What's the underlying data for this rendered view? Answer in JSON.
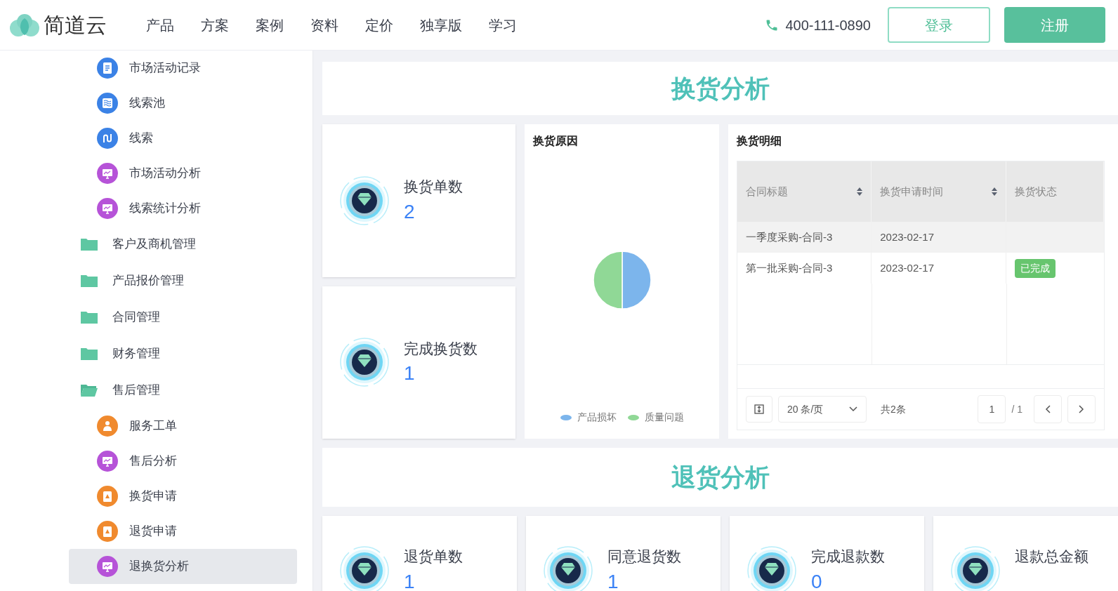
{
  "header": {
    "brand": "简道云",
    "nav": [
      "产品",
      "方案",
      "案例",
      "资料",
      "定价",
      "独享版",
      "学习"
    ],
    "phone": "400-111-0890",
    "login": "登录",
    "register": "注册"
  },
  "sidebar": {
    "upper_items": [
      {
        "label": "市场活动记录",
        "kind": "doc",
        "selected": false
      },
      {
        "label": "线索池",
        "kind": "wave",
        "selected": false
      },
      {
        "label": "线索",
        "kind": "route",
        "selected": false
      },
      {
        "label": "市场活动分析",
        "kind": "monitor",
        "selected": false
      },
      {
        "label": "线索统计分析",
        "kind": "monitor",
        "selected": false
      }
    ],
    "folders": [
      {
        "label": "客户及商机管理",
        "expanded": false
      },
      {
        "label": "产品报价管理",
        "expanded": false
      },
      {
        "label": "合同管理",
        "expanded": false
      },
      {
        "label": "财务管理",
        "expanded": false
      },
      {
        "label": "售后管理",
        "expanded": true,
        "children": [
          {
            "label": "服务工单",
            "kind": "person",
            "selected": false
          },
          {
            "label": "售后分析",
            "kind": "monitor",
            "selected": false
          },
          {
            "label": "换货申请",
            "kind": "clipboard",
            "selected": false
          },
          {
            "label": "退货申请",
            "kind": "clipboard",
            "selected": false
          },
          {
            "label": "退换货分析",
            "kind": "monitor",
            "selected": true
          }
        ]
      }
    ]
  },
  "exchange": {
    "title": "换货分析",
    "stats": [
      {
        "label": "换货单数",
        "value": "2"
      },
      {
        "label": "完成换货数",
        "value": "1"
      }
    ],
    "reason": {
      "title": "换货原因",
      "chart_data": {
        "type": "pie",
        "categories": [
          "产品损坏",
          "质量问题"
        ],
        "values": [
          50,
          50
        ],
        "colors": [
          "#7cb5ec",
          "#90d896"
        ]
      }
    },
    "detail": {
      "title": "换货明细",
      "columns": [
        {
          "label": "合同标题",
          "sortable": true
        },
        {
          "label": "换货申请时间",
          "sortable": true
        },
        {
          "label": "换货状态",
          "sortable": false
        }
      ],
      "rows": [
        {
          "cells": [
            "一季度采购-合同-3",
            "2023-02-17"
          ],
          "status": null,
          "highlighted": true
        },
        {
          "cells": [
            "第一批采购-合同-3",
            "2023-02-17"
          ],
          "status": "已完成",
          "highlighted": false
        }
      ],
      "pager": {
        "page_size": "20 条/页",
        "total": "共2条",
        "page": "1",
        "pages": "/ 1"
      }
    }
  },
  "returns": {
    "title": "退货分析",
    "stats": [
      {
        "label": "退货单数",
        "value": "1"
      },
      {
        "label": "同意退货数",
        "value": "1"
      },
      {
        "label": "完成退款数",
        "value": "0"
      },
      {
        "label": "退款总金额"
      }
    ]
  }
}
